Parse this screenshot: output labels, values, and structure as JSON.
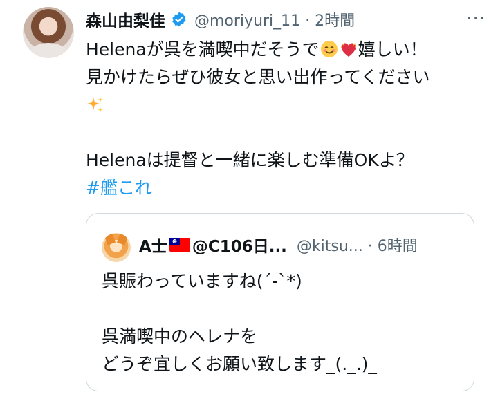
{
  "tweet": {
    "author_name": "森山由梨佳",
    "handle": "@moriyuri_11",
    "time": "· 2時間",
    "more": "···",
    "text_lines": [
      "Helenaが呉を満喫中だそうで",
      "嬉しい！",
      "見かけたらぜひ彼女と思い出作ってください",
      "Helenaは提督と一緒に楽しむ準備OKよ？"
    ],
    "hashtag": "#艦これ",
    "emojis": [
      "smiling-face-icon",
      "heart-with-ribbon-icon",
      "sparkles-icon"
    ]
  },
  "quote": {
    "author_name_prefix": "A士",
    "author_name_suffix": "@C106日...",
    "handle": "@kitsu...",
    "time": "· 6時間",
    "text_lines": [
      "呉賑わっていますね(´-`*)",
      "",
      "呉満喫中のヘレナを",
      "どうぞ宜しくお願い致します_(._.)_"
    ]
  },
  "colors": {
    "hashtag": "#1d9bf0",
    "verified": "#1d9bf0",
    "secondary_text": "#536471",
    "border": "#cfd9de"
  }
}
